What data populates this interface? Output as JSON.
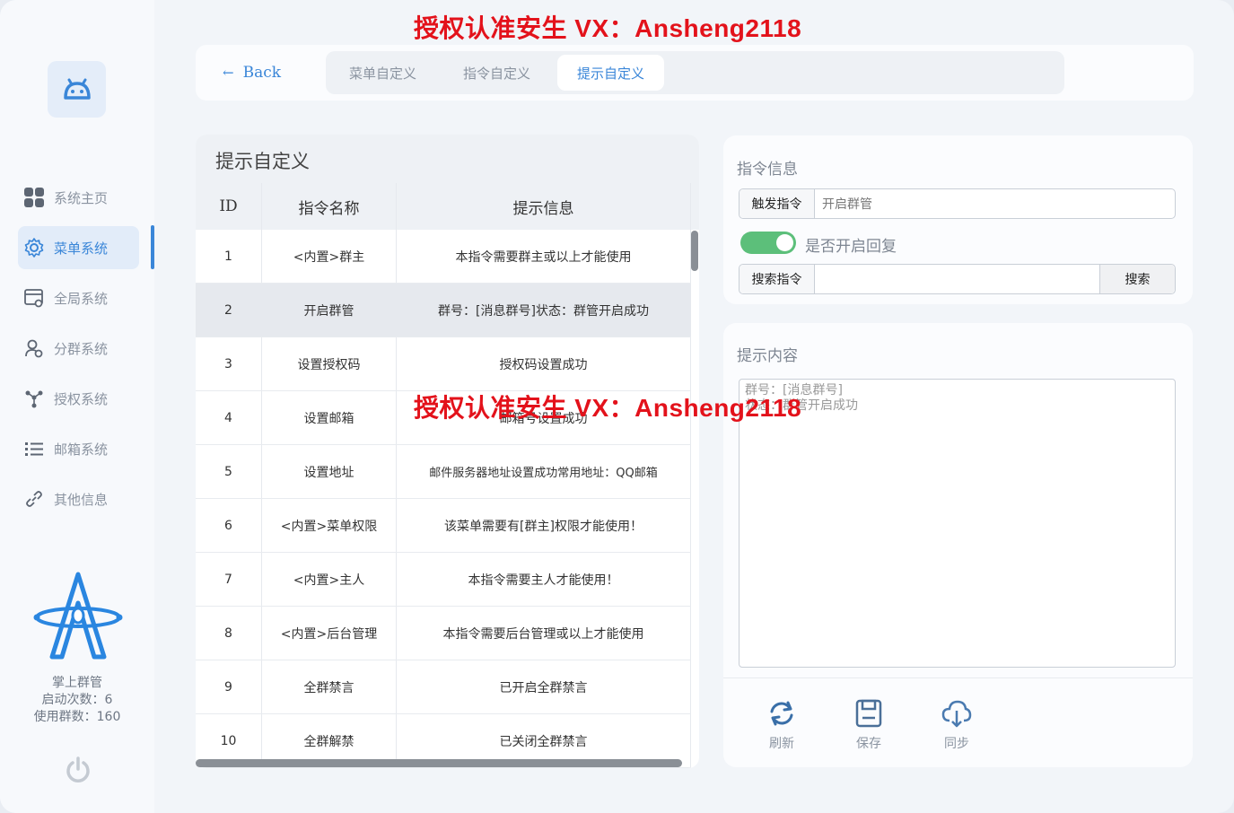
{
  "watermark": {
    "text": "授权认准安生 VX：Ansheng2118"
  },
  "sidebar": {
    "items": [
      {
        "label": "系统主页",
        "icon": "grid-icon"
      },
      {
        "label": "菜单系统",
        "icon": "gear-icon",
        "active": true
      },
      {
        "label": "全局系统",
        "icon": "window-settings-icon"
      },
      {
        "label": "分群系统",
        "icon": "users-icon"
      },
      {
        "label": "授权系统",
        "icon": "network-icon"
      },
      {
        "label": "邮箱系统",
        "icon": "list-icon"
      },
      {
        "label": "其他信息",
        "icon": "link-icon"
      }
    ],
    "brand_name": "掌上群管",
    "launch_count": "启动次数：6",
    "group_count": "使用群数：160"
  },
  "topbar": {
    "back_label": "Back",
    "tabs": [
      {
        "label": "菜单自定义"
      },
      {
        "label": "指令自定义"
      },
      {
        "label": "提示自定义",
        "active": true
      }
    ]
  },
  "table": {
    "title": "提示自定义",
    "headers": {
      "id": "ID",
      "name": "指令名称",
      "message": "提示信息"
    },
    "rows": [
      {
        "id": "1",
        "name": "<内置>群主",
        "message": "本指令需要群主或以上才能使用"
      },
      {
        "id": "2",
        "name": "开启群管",
        "message": "群号：[消息群号]状态：群管开启成功"
      },
      {
        "id": "3",
        "name": "设置授权码",
        "message": "授权码设置成功"
      },
      {
        "id": "4",
        "name": "设置邮箱",
        "message": "邮箱号设置成功"
      },
      {
        "id": "5",
        "name": "设置地址",
        "message": "邮件服务器地址设置成功常用地址：QQ邮箱"
      },
      {
        "id": "6",
        "name": "<内置>菜单权限",
        "message": "该菜单需要有[群主]权限才能使用！"
      },
      {
        "id": "7",
        "name": "<内置>主人",
        "message": "本指令需要主人才能使用！"
      },
      {
        "id": "8",
        "name": "<内置>后台管理",
        "message": "本指令需要后台管理或以上才能使用"
      },
      {
        "id": "9",
        "name": "全群禁言",
        "message": "已开启全群禁言"
      },
      {
        "id": "10",
        "name": "全群解禁",
        "message": "已关闭全群禁言"
      }
    ]
  },
  "info": {
    "title": "指令信息",
    "trigger_label": "触发指令",
    "trigger_value": "开启群管",
    "reply_toggle_label": "是否开启回复",
    "reply_enabled": true,
    "search_label": "搜索指令",
    "search_value": "",
    "search_button": "搜索"
  },
  "content": {
    "title": "提示内容",
    "text": "群号：[消息群号]\n状态：群管开启成功"
  },
  "actions": {
    "refresh": "刷新",
    "save": "保存",
    "sync": "同步"
  },
  "colors": {
    "accent": "#3a86d8",
    "toggle_on": "#5cbf7a",
    "watermark": "#e3121b"
  }
}
